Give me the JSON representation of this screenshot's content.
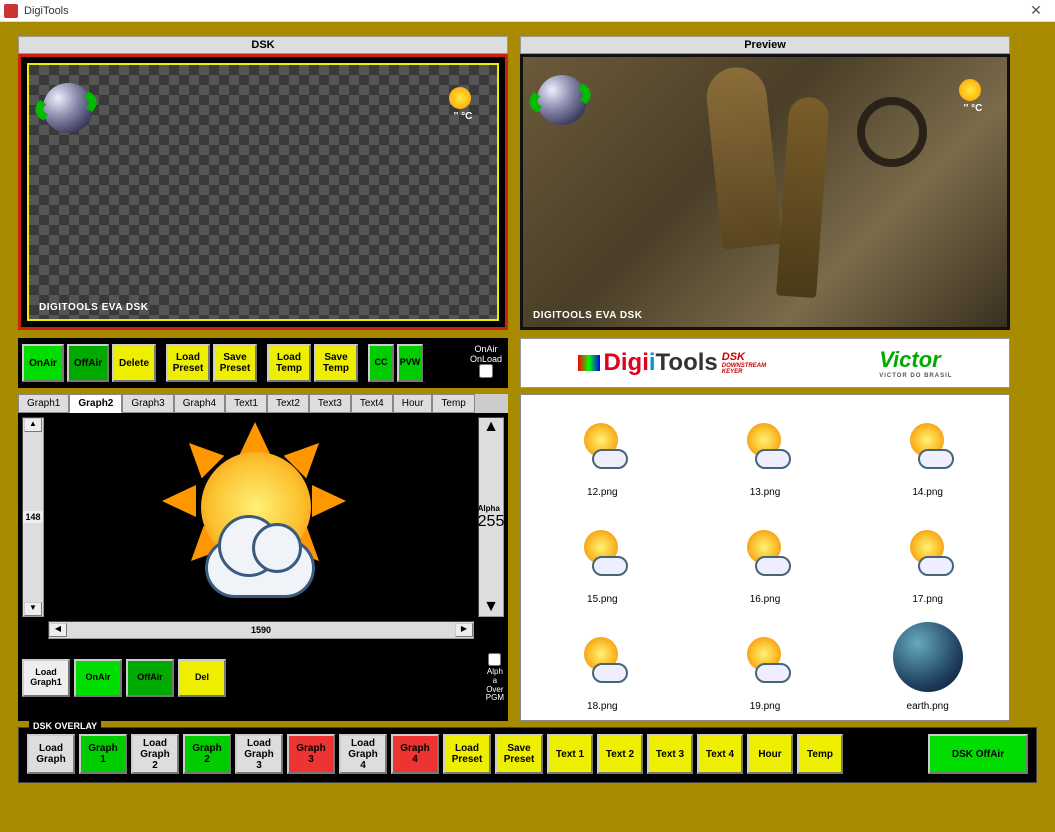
{
  "window": {
    "title": "DigiTools"
  },
  "panels": {
    "dsk_title": "DSK",
    "preview_title": "Preview",
    "watermark": "DIGITOOLS EVA DSK",
    "overlay_temp": "'' °C"
  },
  "controls": {
    "onair": "OnAir",
    "offair": "OffAir",
    "delete": "Delete",
    "load_preset": "Load\nPreset",
    "save_preset": "Save\nPreset",
    "load_temp": "Load\nTemp",
    "save_temp": "Save\nTemp",
    "cc": "CC",
    "pvw": "PVW",
    "onair_onload_label": "OnAir\nOnLoad"
  },
  "brand": {
    "digi": "Digi",
    "tools": "Tools",
    "dsk": "DSK",
    "sub": "DOWNSTREAM\nKEYER",
    "victor": "Victor",
    "victor_sub": "VICTOR DO BRASIL"
  },
  "tabs": [
    "Graph1",
    "Graph2",
    "Graph3",
    "Graph4",
    "Text1",
    "Text2",
    "Text3",
    "Text4",
    "Hour",
    "Temp"
  ],
  "active_tab": "Graph2",
  "editor": {
    "v_value": "148",
    "h_value": "1590",
    "alpha_label": "Alpha",
    "alpha_value": "255",
    "load_graph1": "Load\nGraph1",
    "onair": "OnAir",
    "offair": "OffAir",
    "del": "Del",
    "alpha_over": "Alph\na\nOver\nPGM"
  },
  "thumbs": [
    "12.png",
    "13.png",
    "14.png",
    "15.png",
    "16.png",
    "17.png",
    "18.png",
    "19.png",
    "earth.png"
  ],
  "overlay": {
    "legend": "DSK OVERLAY",
    "buttons": [
      {
        "label": "Load\nGraph",
        "style": "bb-gray"
      },
      {
        "label": "Graph\n1",
        "style": "bb-green"
      },
      {
        "label": "Load\nGraph\n2",
        "style": "bb-gray"
      },
      {
        "label": "Graph\n2",
        "style": "bb-green"
      },
      {
        "label": "Load\nGraph\n3",
        "style": "bb-gray"
      },
      {
        "label": "Graph\n3",
        "style": "bb-red"
      },
      {
        "label": "Load\nGraph\n4",
        "style": "bb-gray"
      },
      {
        "label": "Graph\n4",
        "style": "bb-red"
      },
      {
        "label": "Load\nPreset",
        "style": "bb-yellow"
      },
      {
        "label": "Save\nPreset",
        "style": "bb-yellow"
      },
      {
        "label": "Text 1",
        "style": "bb-yellow2"
      },
      {
        "label": "Text 2",
        "style": "bb-yellow2"
      },
      {
        "label": "Text 3",
        "style": "bb-yellow2"
      },
      {
        "label": "Text 4",
        "style": "bb-yellow2"
      },
      {
        "label": "Hour",
        "style": "bb-yellow2"
      },
      {
        "label": "Temp",
        "style": "bb-yellow2"
      }
    ],
    "dsk_offair": "DSK OffAir"
  }
}
